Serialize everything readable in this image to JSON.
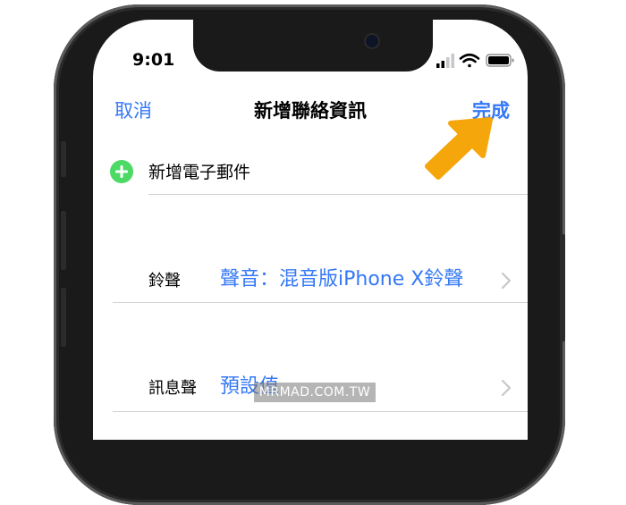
{
  "status_bar": {
    "time": "9:01",
    "icons": [
      "cellular-signal-icon",
      "wifi-icon",
      "battery-icon"
    ]
  },
  "nav": {
    "cancel_label": "取消",
    "title": "新增聯絡資訊",
    "done_label": "完成"
  },
  "add_email": {
    "label": "新增電子郵件",
    "icon": "plus-circle-icon"
  },
  "rows": [
    {
      "label": "鈴聲",
      "value": "聲音：混音版iPhone X鈴聲"
    },
    {
      "label": "訊息聲",
      "value": "預設值"
    }
  ],
  "annotation": {
    "icon": "pointer-arrow-icon",
    "color": "#f5a60a"
  },
  "watermark": "MRMAD.COM.TW",
  "colors": {
    "ios_blue": "#3478f6",
    "ios_green": "#4cd964",
    "separator": "#d1d1d6"
  }
}
